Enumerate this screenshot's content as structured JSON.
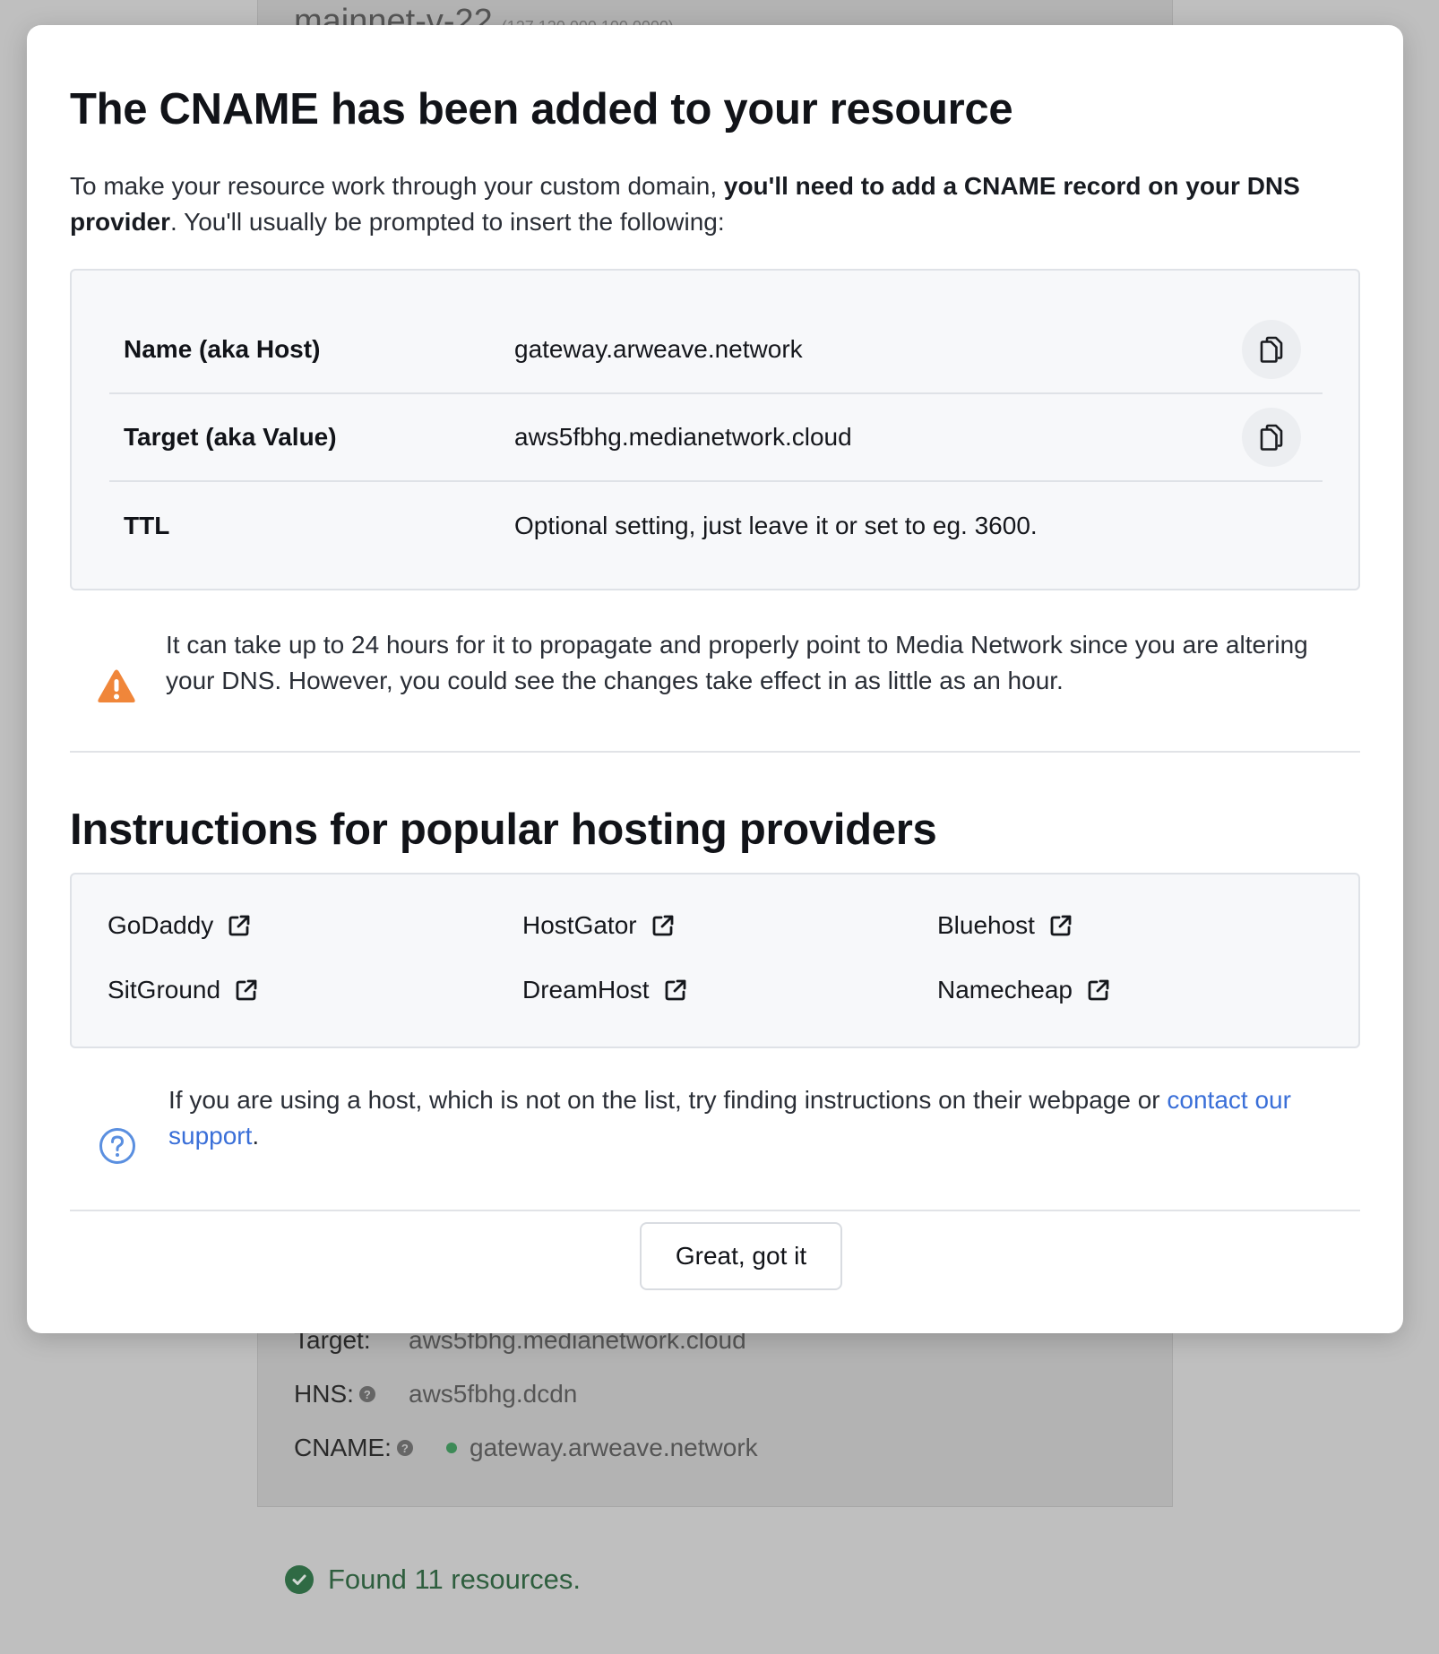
{
  "background": {
    "card_title": "mainnet-v-22",
    "card_subtitle": "(127.120.000.100.0000)",
    "rows": [
      {
        "key": "Target:",
        "value": "aws5fbhg.medianetwork.cloud"
      },
      {
        "key": "HNS:",
        "value": "aws5fbhg.dcdn"
      },
      {
        "key": "CNAME:",
        "value": "gateway.arweave.network"
      }
    ],
    "found_text": "Found 11 resources."
  },
  "modal": {
    "title": "The CNAME has been added to your resource",
    "intro_pre": "To make your resource work through your custom domain, ",
    "intro_bold": "you'll need to add a CNAME record on your DNS provider",
    "intro_post": ". You'll usually be prompted to insert the following:",
    "dns": [
      {
        "key": "Name (aka Host)",
        "value": "gateway.arweave.network"
      },
      {
        "key": "Target (aka Value)",
        "value": "aws5fbhg.medianetwork.cloud"
      },
      {
        "key": "TTL",
        "value": "Optional setting, just leave it or set to eg. 3600."
      }
    ],
    "warning": "It can take up to 24 hours for it to propagate and properly point to Media Network since you are altering your DNS. However, you could see the changes take effect in as little as an hour.",
    "providers_title": "Instructions for popular hosting providers",
    "providers": [
      "GoDaddy",
      "HostGator",
      "Bluehost",
      "SitGround",
      "DreamHost",
      "Namecheap"
    ],
    "help_pre": "If you are using a host, which is not on the list, try finding instructions on their webpage or ",
    "help_link": "contact our support",
    "help_post": ".",
    "ok_button": "Great, got it"
  },
  "colors": {
    "warning_icon": "#f0863a",
    "help_icon": "#5a8fe0",
    "link": "#3a6fd8",
    "found_check": "#2f6a44"
  },
  "icons": {
    "copy": "copy-icon",
    "external": "external-link-icon",
    "warning": "warning-triangle-icon",
    "help": "question-circle-icon",
    "check": "check-circle-icon"
  }
}
